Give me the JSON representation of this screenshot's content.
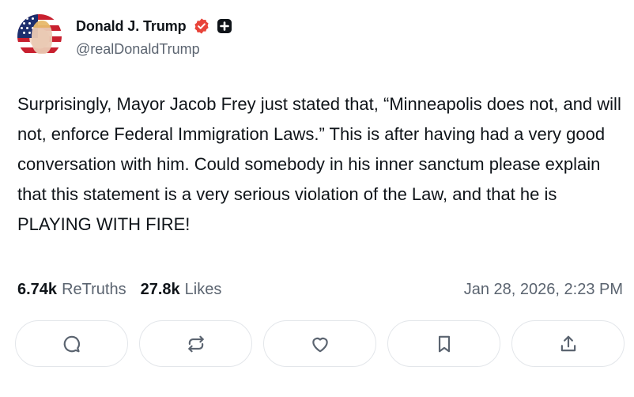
{
  "author": {
    "display_name": "Donald J. Trump",
    "handle": "@realDonaldTrump",
    "verified_badge_color": "#e8443a",
    "badges": [
      "verified-icon",
      "plus-badge-icon"
    ]
  },
  "post": {
    "text": "Surprisingly, Mayor Jacob Frey just stated that, “Minneapolis does not, and will not, enforce Federal Immigration Laws.” This is after having had a very good conversation with him. Could somebody in his inner sanctum please explain that this statement is a very serious violation of the Law, and that he is PLAYING WITH FIRE!",
    "retruths_count": "6.74k",
    "retruths_label": "ReTruths",
    "likes_count": "27.8k",
    "likes_label": "Likes",
    "timestamp": "Jan 28, 2026, 2:23 PM"
  },
  "actions": [
    {
      "name": "reply",
      "icon": "comment-icon"
    },
    {
      "name": "retruth",
      "icon": "repost-icon"
    },
    {
      "name": "like",
      "icon": "heart-icon"
    },
    {
      "name": "bookmark",
      "icon": "bookmark-icon"
    },
    {
      "name": "share",
      "icon": "share-icon"
    }
  ],
  "colors": {
    "text_primary": "#0f1419",
    "text_secondary": "#5b6470",
    "button_border": "#e3e6ea"
  }
}
